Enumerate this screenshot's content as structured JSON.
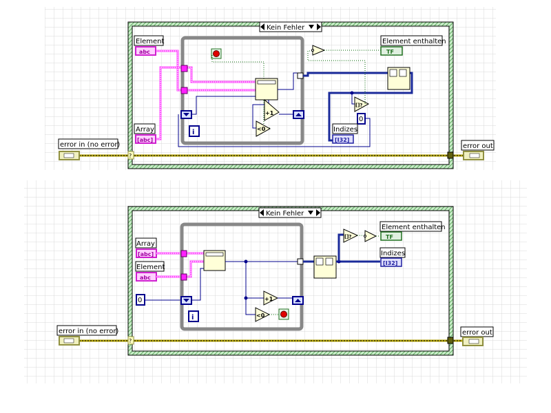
{
  "colors": {
    "string_wire": "#ff40ff",
    "integer_wire": "#00008c",
    "boolean_wire": "#006600",
    "error_wire": "#b0a000",
    "case_border": "#6fbf6f",
    "loop_border": "#888888",
    "grid": "#d9d9d9"
  },
  "diagram_top": {
    "case_selector": "Kein Fehler",
    "error_in_label": "error in (no error)",
    "error_out_label": "error out",
    "element_label": "Element",
    "element_control": "abc",
    "array_label": "Array",
    "array_control": "[abc]",
    "element_enthalten_label": "Element enthalten",
    "element_enthalten_indicator": "TF",
    "indizes_label": "Indizes",
    "indizes_indicator": "[I32]",
    "constant_zero": "0",
    "increment": "+1",
    "less_than_zero": "<0",
    "empty_array": "[]?",
    "iteration": "i"
  },
  "diagram_bottom": {
    "case_selector": "Kein Fehler",
    "error_in_label": "error in (no error)",
    "error_out_label": "error out",
    "array_label": "Array",
    "array_control": "[abc]",
    "element_label": "Element",
    "element_control": "abc",
    "constant_zero": "0",
    "element_enthalten_label": "Element enthalten",
    "element_enthalten_indicator": "TF",
    "indizes_label": "Indizes",
    "indizes_indicator": "[I32]",
    "increment": "+1",
    "less_than_zero": "<0",
    "empty_array": "[]?",
    "iteration": "i"
  }
}
